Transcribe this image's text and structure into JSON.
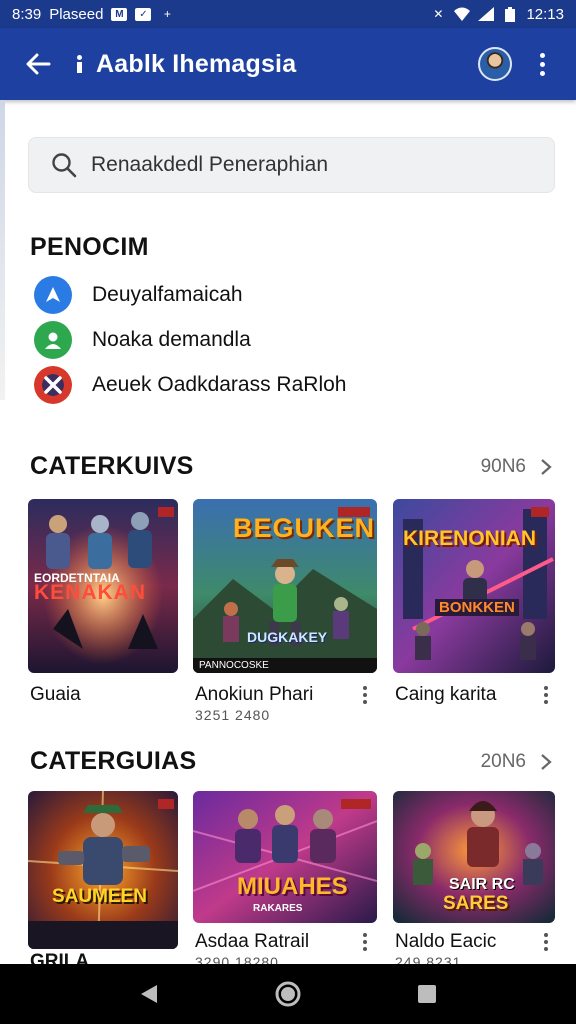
{
  "status_bar": {
    "time": "8:39",
    "notification_text": "Plaseed",
    "clock": "12:13"
  },
  "app_bar": {
    "title": "Aablk Ihemagsia"
  },
  "search": {
    "text": "Renaakdedl Peneraphian"
  },
  "recent": {
    "title": "PENOCIM",
    "items": [
      {
        "label": "Deuyalfamaicah",
        "icon": "navigation-icon",
        "color": "#2a7be4"
      },
      {
        "label": "Noaka demandla",
        "icon": "contact-icon",
        "color": "#2ea84f"
      },
      {
        "label": "Aeuek Oadkdarass RaRloh",
        "icon": "game-x-icon",
        "color": "#d8372b"
      }
    ]
  },
  "section_one": {
    "title": "CATERKUIVS",
    "more_label": "90N6",
    "cards": [
      {
        "name": "Guaia",
        "sub": "",
        "art_title": "KENAKAN",
        "art_top": "EORDETNTAIA"
      },
      {
        "name": "Anokiun Phari",
        "sub": "3251 2480",
        "art_title": "BEGUKEN",
        "art_bottom": "DUGKAKEY",
        "tag": "PANNOCOSKE"
      },
      {
        "name": "Caing karita",
        "sub": "",
        "art_title": "KIRENONIAN",
        "art_bottom": "BONKKEN"
      }
    ]
  },
  "section_two": {
    "title": "CATERGUIAS",
    "more_label": "20N6",
    "cards": [
      {
        "name": "GRILA",
        "sub": "",
        "art_title": "SAUMEEN"
      },
      {
        "name": "Asdaa Ratrail",
        "sub": "3290 18280",
        "art_title": "MIUAHES",
        "art_bottom": "RAKARES"
      },
      {
        "name": "Naldo Eacic",
        "sub": "249 8231",
        "art_title": "SAIR RC",
        "art_bottom": "SARES"
      }
    ]
  },
  "colors": {
    "status_bar": "#1c3a8c",
    "app_bar": "#1e40a0",
    "nav_bar": "#000000"
  }
}
